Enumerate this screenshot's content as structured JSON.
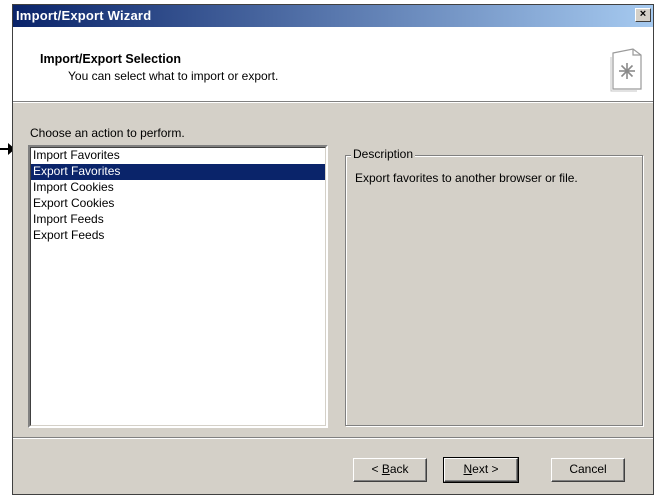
{
  "window": {
    "title": "Import/Export Wizard",
    "close_label": "×"
  },
  "header": {
    "title": "Import/Export Selection",
    "subtitle": "You can select what to import or export."
  },
  "prompt": "Choose an action to perform.",
  "actions": [
    "Import Favorites",
    "Export Favorites",
    "Import Cookies",
    "Export Cookies",
    "Import Feeds",
    "Export Feeds"
  ],
  "selected_action": "Export Favorites",
  "description": {
    "label": "Description",
    "text": "Export favorites to another browser or file."
  },
  "buttons": {
    "back": {
      "prefix": "< ",
      "accel": "B",
      "rest": "ack"
    },
    "next": {
      "accel": "N",
      "rest": "ext >"
    },
    "cancel": "Cancel"
  },
  "colors": {
    "title_start": "#0a246a",
    "title_end": "#a6caf0",
    "selection": "#0a246a",
    "face": "#d4d0c8"
  }
}
